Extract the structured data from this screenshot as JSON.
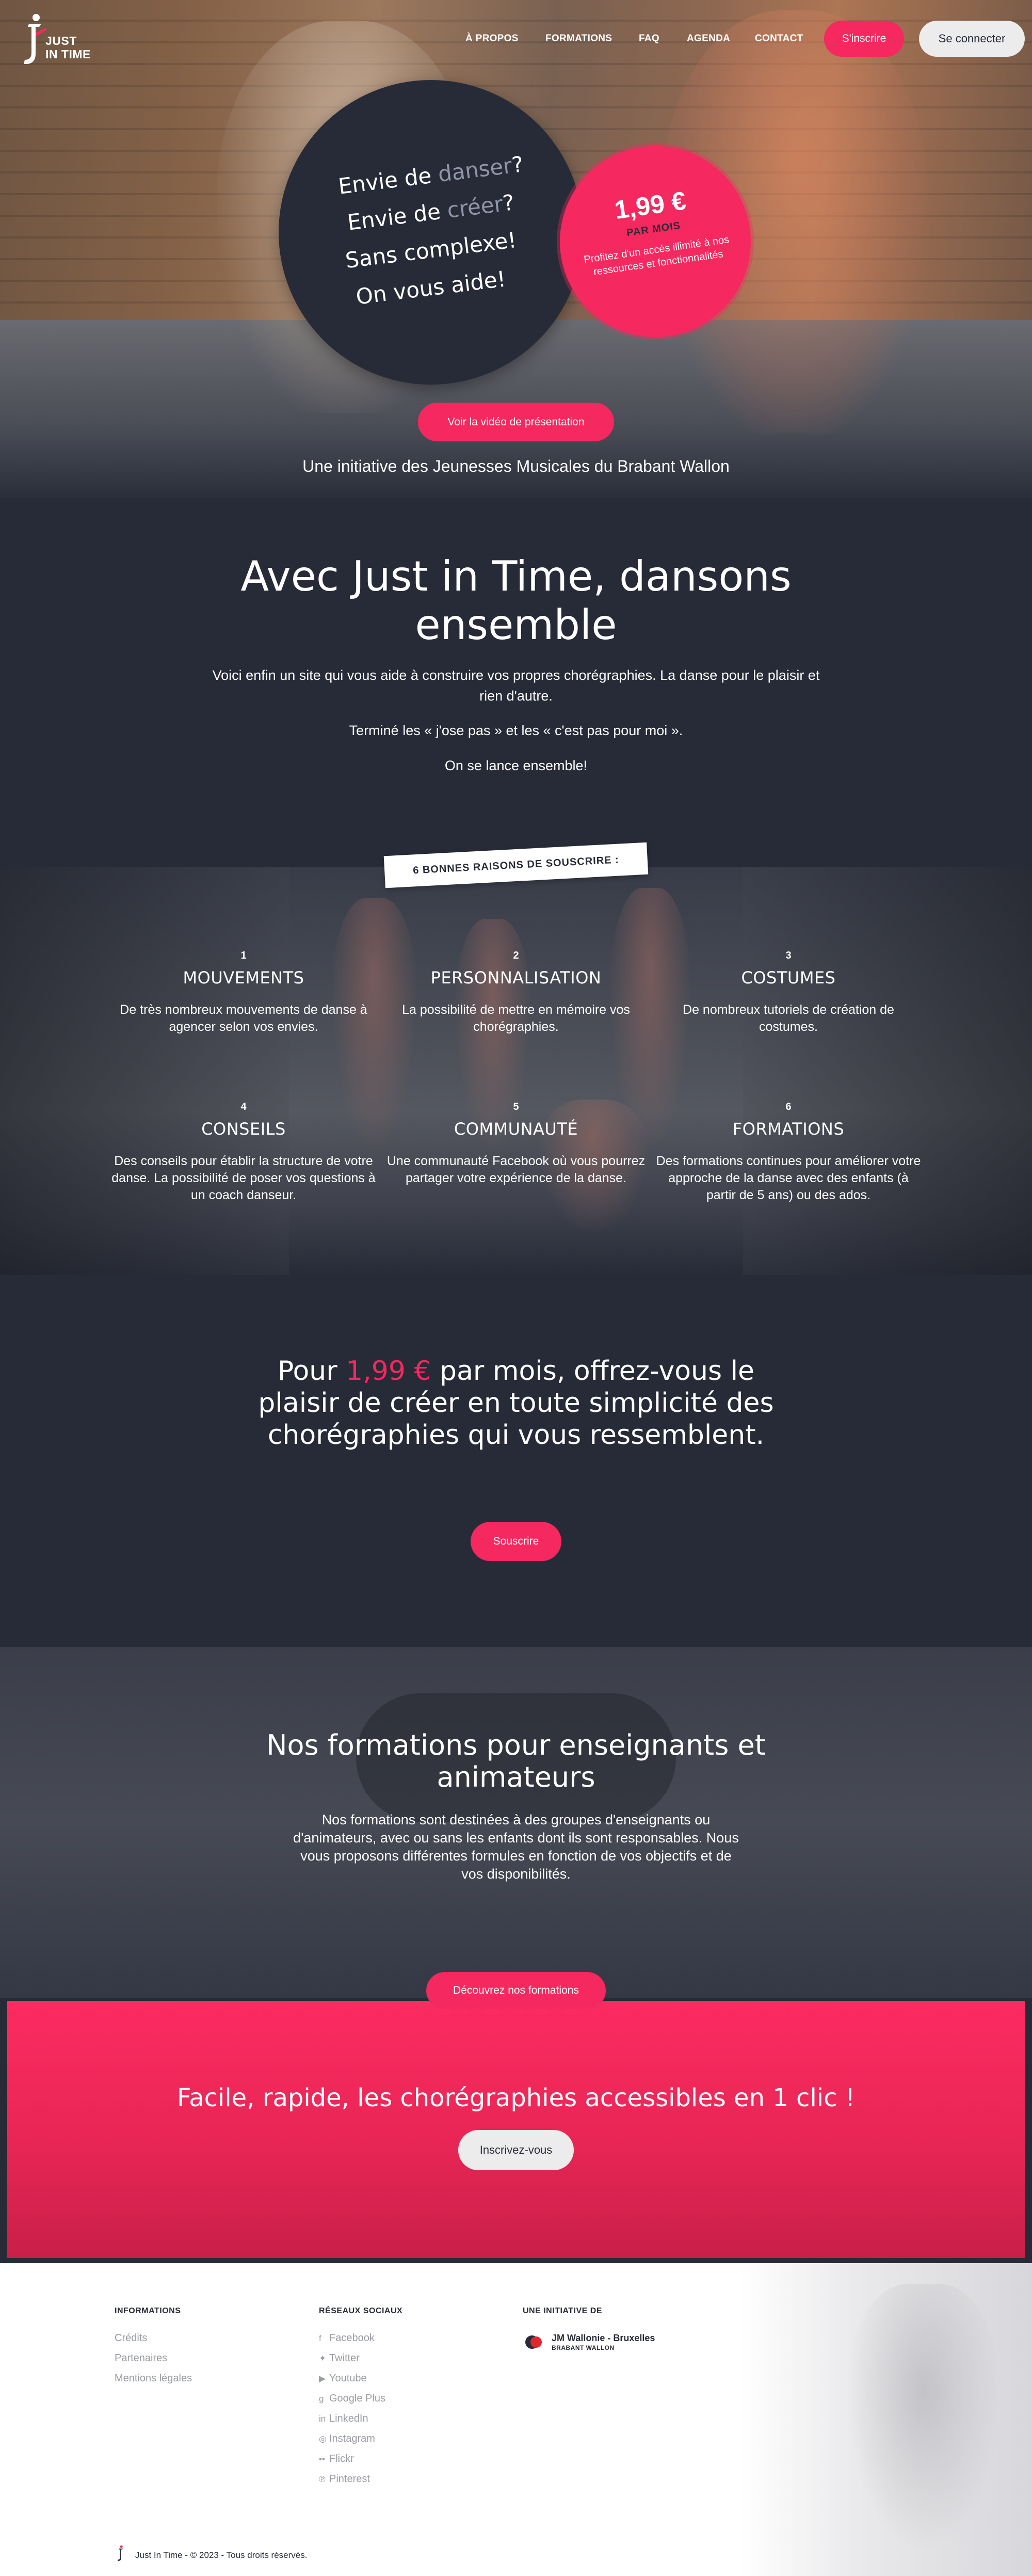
{
  "brand": {
    "logo_line1": "JUST",
    "logo_line2": "IN TIME"
  },
  "nav": {
    "links": [
      "À PROPOS",
      "FORMATIONS",
      "FAQ",
      "AGENDA",
      "CONTACT"
    ],
    "signup": "S'inscrire",
    "login": "Se connecter"
  },
  "hero": {
    "line1_a": "Envie de ",
    "line1_b": "danser",
    "line1_c": "?",
    "line2_a": "Envie de ",
    "line2_b": "créer",
    "line2_c": "?",
    "line3": "Sans complexe!",
    "line4": "On vous aide!",
    "badge_price": "1,99 €",
    "badge_period": "PAR MOIS",
    "badge_text": "Profitez d'un accès illimité à nos ressources et fonctionnalités",
    "video_button": "Voir la vidéo de présentation",
    "subtitle": "Une initiative des Jeunesses Musicales du Brabant Wallon"
  },
  "intro": {
    "title": "Avec Just in Time, dansons ensemble",
    "p1": "Voici enfin un site qui vous aide à construire vos propres chorégraphies. La danse pour le plaisir et rien d'autre.",
    "p2": "Terminé les « j'ose pas » et les « c'est pas pour moi ».",
    "p3": "On se lance ensemble!"
  },
  "reasons": {
    "tag": "6 BONNES RAISONS DE SOUSCRIRE :",
    "items": [
      {
        "num": "1",
        "title": "MOUVEMENTS",
        "text": "De très nombreux mouvements de danse à agencer selon vos envies."
      },
      {
        "num": "2",
        "title": "PERSONNALISATION",
        "text": "La possibilité de mettre en mémoire vos chorégraphies."
      },
      {
        "num": "3",
        "title": "COSTUMES",
        "text": "De nombreux tutoriels de création de costumes."
      },
      {
        "num": "4",
        "title": "CONSEILS",
        "text": "Des conseils pour établir la structure de votre danse. La possibilité de poser vos questions à un coach danseur."
      },
      {
        "num": "5",
        "title": "COMMUNAUTÉ",
        "text": "Une communauté Facebook où vous pourrez partager votre expérience de la danse."
      },
      {
        "num": "6",
        "title": "FORMATIONS",
        "text": "Des formations continues pour améliorer votre approche de la danse avec des enfants (à partir de 5 ans) ou des ados."
      }
    ]
  },
  "offer": {
    "title_a": "Pour ",
    "title_price": "1,99 €",
    "title_b": " par mois, offrez-vous le plaisir de créer en toute simplicité des chorégraphies qui vous ressemblent.",
    "button": "Souscrire"
  },
  "formations": {
    "title": "Nos formations pour enseignants et animateurs",
    "text": "Nos formations sont destinées à des groupes d'enseignants ou d'animateurs, avec ou sans les enfants dont ils sont responsables. Nous vous proposons différentes formules en fonction de vos objectifs et de vos disponibilités.",
    "button": "Découvrez nos formations"
  },
  "cta": {
    "title": "Facile, rapide, les chorégraphies accessibles en 1 clic !",
    "button": "Inscrivez-vous"
  },
  "footer": {
    "info_title": "INFORMATIONS",
    "info_links": [
      "Crédits",
      "Partenaires",
      "Mentions légales"
    ],
    "social_title": "RÉSEAUX SOCIAUX",
    "social_links": [
      {
        "icon": "facebook-icon",
        "glyph": "f",
        "label": "Facebook"
      },
      {
        "icon": "twitter-icon",
        "glyph": "✦",
        "label": "Twitter"
      },
      {
        "icon": "youtube-icon",
        "glyph": "▶",
        "label": "Youtube"
      },
      {
        "icon": "google-plus-icon",
        "glyph": "g",
        "label": "Google Plus"
      },
      {
        "icon": "linkedin-icon",
        "glyph": "in",
        "label": "LinkedIn"
      },
      {
        "icon": "instagram-icon",
        "glyph": "◎",
        "label": "Instagram"
      },
      {
        "icon": "flickr-icon",
        "glyph": "••",
        "label": "Flickr"
      },
      {
        "icon": "pinterest-icon",
        "glyph": "℗",
        "label": "Pinterest"
      }
    ],
    "initiative_title": "UNE INITIATIVE DE",
    "partner_name": "JM Wallonie - Bruxelles",
    "partner_sub": "BRABANT WALLON",
    "copyright": "Just In Time - © 2023 - Tous droits réservés."
  },
  "colors": {
    "accent": "#f5285f",
    "dark": "#272b37",
    "light_button": "#ececec"
  }
}
